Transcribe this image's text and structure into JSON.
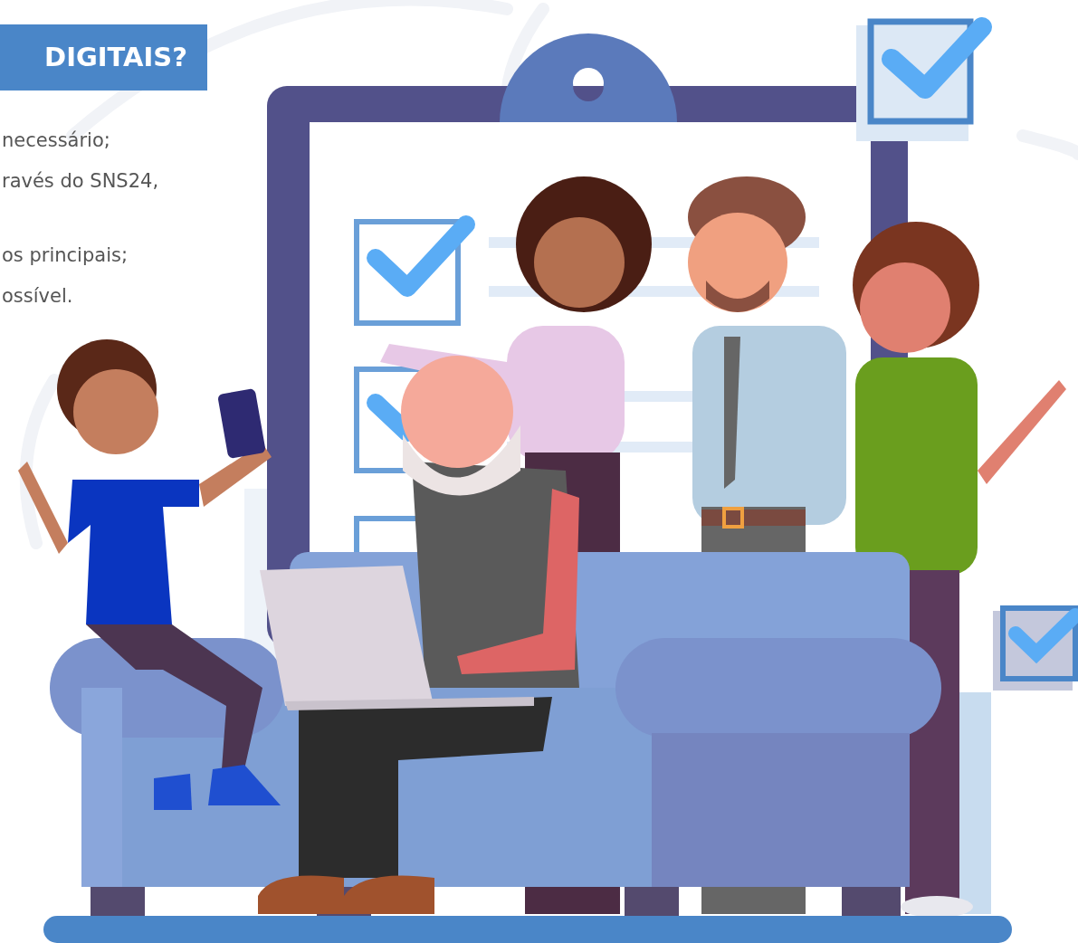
{
  "heading": "DIGITAIS?",
  "list_lines": [
    "necessário;",
    "ravés do SNS24,",
    "os principais;",
    "ossível."
  ]
}
